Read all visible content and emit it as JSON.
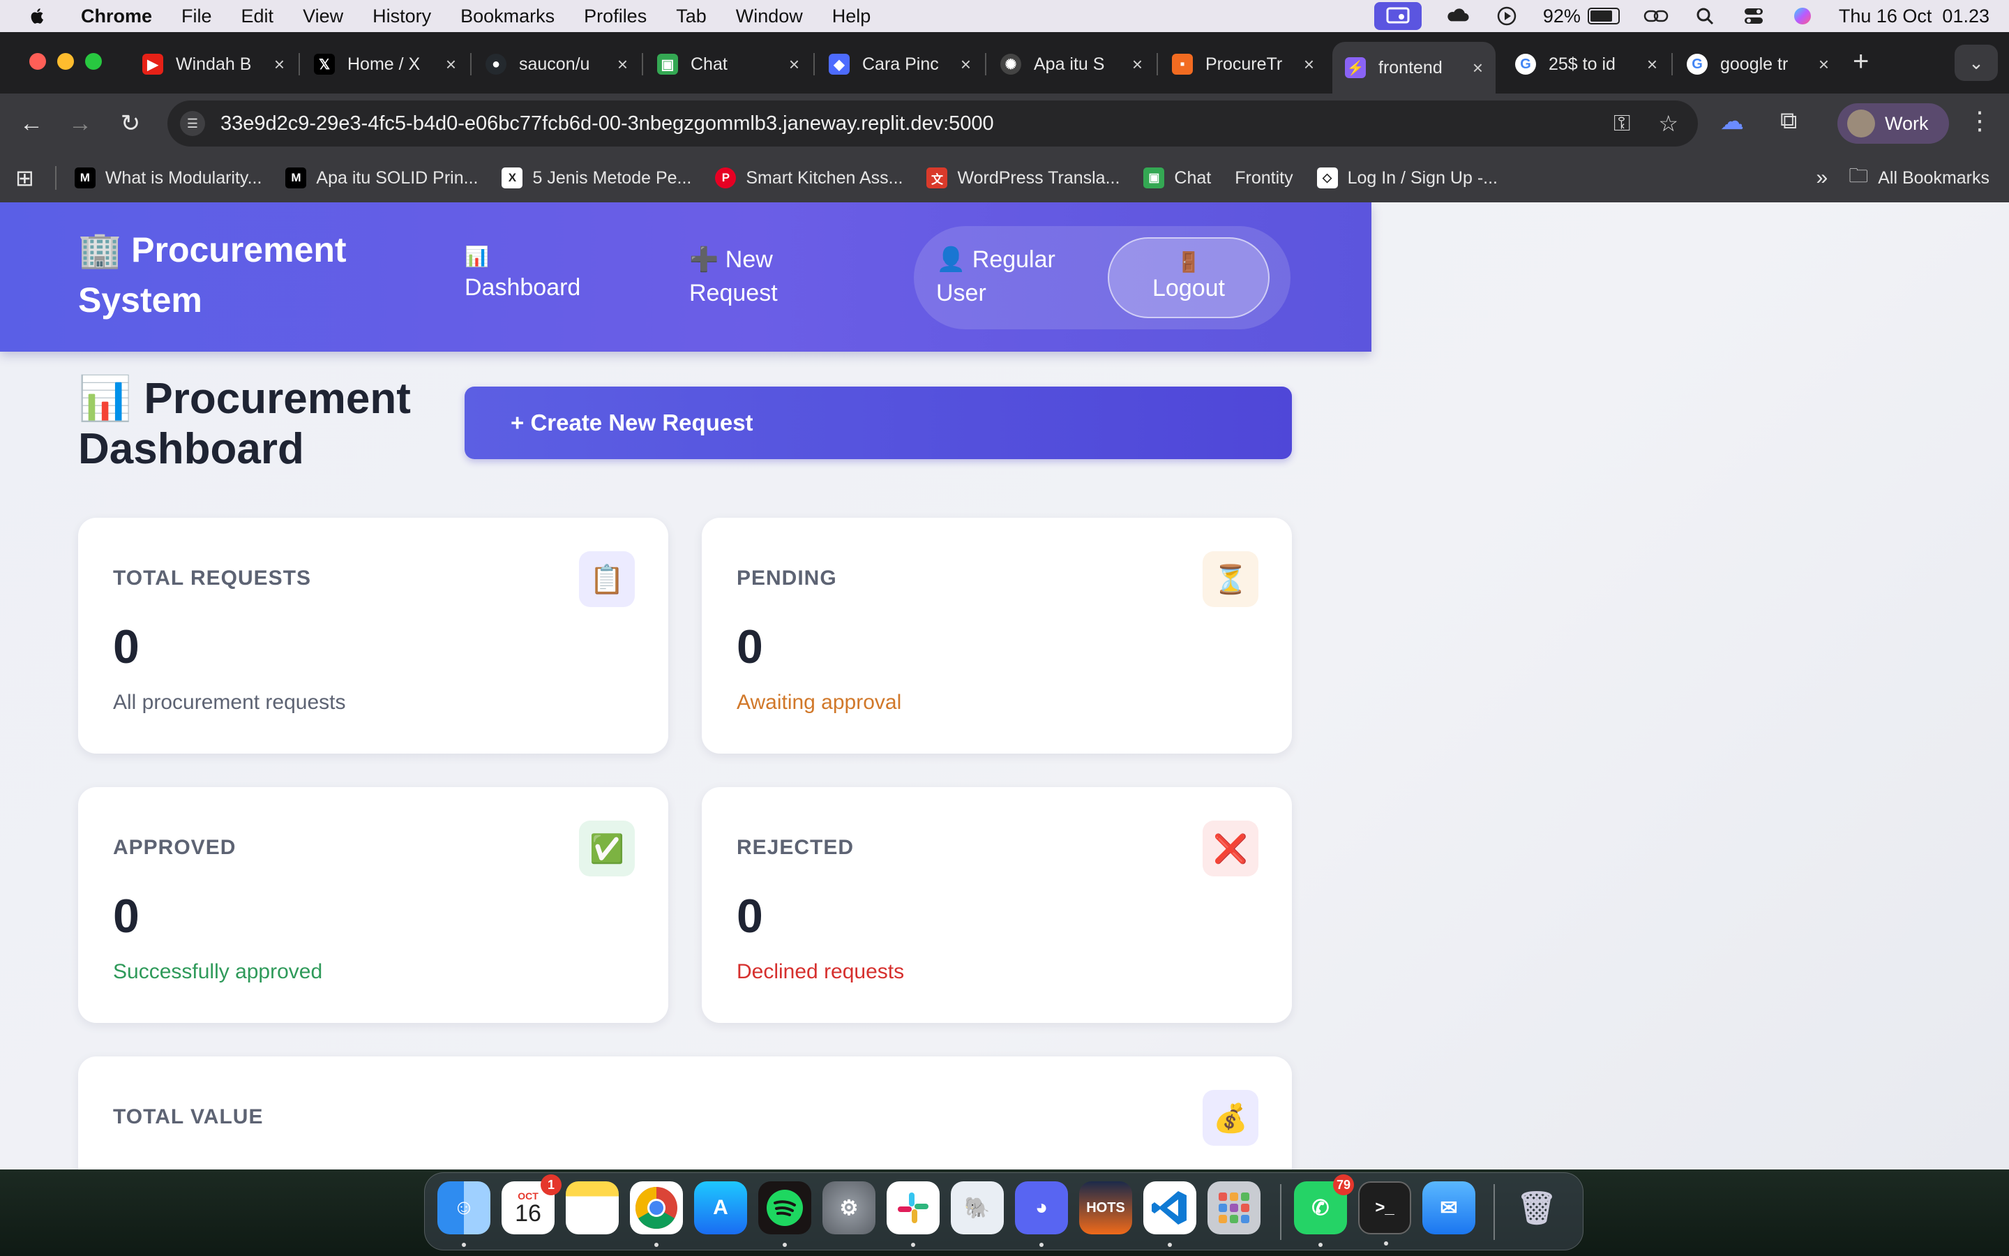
{
  "menubar": {
    "app_name": "Chrome",
    "items": [
      "File",
      "Edit",
      "View",
      "History",
      "Bookmarks",
      "Profiles",
      "Tab",
      "Window",
      "Help"
    ],
    "battery": "92%",
    "battery_level": 0.92,
    "datetime": "Thu 16 Oct  01.23",
    "status_icons": [
      "screen-share-icon",
      "cloud-icon",
      "play-icon",
      "battery-icon",
      "link-icon",
      "search-icon",
      "control-center-icon",
      "siri-icon"
    ]
  },
  "tabs": [
    {
      "title": "Windah B",
      "icon": "youtube-icon",
      "color": "#e62117"
    },
    {
      "title": "Home / X",
      "icon": "x-icon",
      "color": "#000000"
    },
    {
      "title": "saucon/u",
      "icon": "github-icon",
      "color": "#24292e"
    },
    {
      "title": "Chat",
      "icon": "chat-icon",
      "color": "#34a853"
    },
    {
      "title": "Cara Pinc",
      "icon": "bird-icon",
      "color": "#4d6bfe"
    },
    {
      "title": "Apa itu S",
      "icon": "openai-icon",
      "color": "#444444"
    },
    {
      "title": "ProcureTr",
      "icon": "procure-icon",
      "color": "#f26b21"
    },
    {
      "title": "frontend",
      "icon": "vite-icon",
      "color": "#8a63f5",
      "active": true
    },
    {
      "title": "25$ to id",
      "icon": "google-icon",
      "color": "#4285f4"
    },
    {
      "title": "google tr",
      "icon": "google-icon",
      "color": "#4285f4"
    }
  ],
  "address_bar": {
    "url": "33e9d2c9-29e3-4fc5-b4d0-e06bc77fcb6d-00-3nbegzgommlb3.janeway.replit.dev:5000"
  },
  "profile": {
    "label": "Work"
  },
  "bookmarks": [
    {
      "title": "What is Modularity...",
      "icon": "medium-icon",
      "color": "#000000"
    },
    {
      "title": "Apa itu SOLID Prin...",
      "icon": "medium-icon",
      "color": "#000000"
    },
    {
      "title": "5 Jenis Metode Pe...",
      "icon": "xendit-icon",
      "color": "#ffffff"
    },
    {
      "title": "Smart Kitchen Ass...",
      "icon": "pinterest-icon",
      "color": "#e60023"
    },
    {
      "title": "WordPress Transla...",
      "icon": "translate-icon",
      "color": "#d93a2b"
    },
    {
      "title": "Chat",
      "icon": "chat-icon",
      "color": "#34a853"
    },
    {
      "title": "Frontity",
      "icon": "",
      "color": ""
    },
    {
      "title": "Log In / Sign Up -...",
      "icon": "codepen-icon",
      "color": "#ffffff"
    }
  ],
  "bookmarks_all": "All Bookmarks",
  "app": {
    "brand": "🏢 Procurement System",
    "nav_dashboard_icon": "📊",
    "nav_dashboard": "Dashboard",
    "nav_new_request": "➕ New Request",
    "user_label": "👤 Regular User",
    "logout_icon": "🚪",
    "logout_label": "Logout"
  },
  "dashboard": {
    "title": "📊 Procurement Dashboard",
    "create_button": "+ Create New Request",
    "cards": {
      "total": {
        "label": "TOTAL REQUESTS",
        "icon": "📋",
        "value": "0",
        "subtitle": "All procurement requests",
        "sub_color": "#5d6373",
        "icon_bg": "#ecebff"
      },
      "pending": {
        "label": "PENDING",
        "icon": "⏳",
        "value": "0",
        "subtitle": "Awaiting approval",
        "sub_color": "#d1782a",
        "icon_bg": "#fdf3e6"
      },
      "approved": {
        "label": "APPROVED",
        "icon": "✅",
        "value": "0",
        "subtitle": "Successfully approved",
        "sub_color": "#2f9a5a",
        "icon_bg": "#e6f6ec"
      },
      "rejected": {
        "label": "REJECTED",
        "icon": "❌",
        "value": "0",
        "subtitle": "Declined requests",
        "sub_color": "#d6302e",
        "icon_bg": "#fdeaea"
      },
      "value": {
        "label": "TOTAL VALUE",
        "icon": "💰",
        "icon_bg": "#ecebff"
      }
    }
  },
  "dock": {
    "calendar_month": "OCT",
    "calendar_day": "16",
    "calendar_badge": "1",
    "whatsapp_badge": "79",
    "hots_label": "HOTS",
    "apps": [
      "finder-icon",
      "calendar-icon",
      "notes-icon",
      "chrome-icon",
      "app-store-icon",
      "spotify-icon",
      "system-settings-icon",
      "slack-icon",
      "postgres-icon",
      "discord-icon",
      "hots-icon",
      "vscode-icon",
      "launchpad-icon",
      "whatsapp-icon",
      "terminal-icon",
      "mail-icon",
      "trash-icon"
    ]
  }
}
